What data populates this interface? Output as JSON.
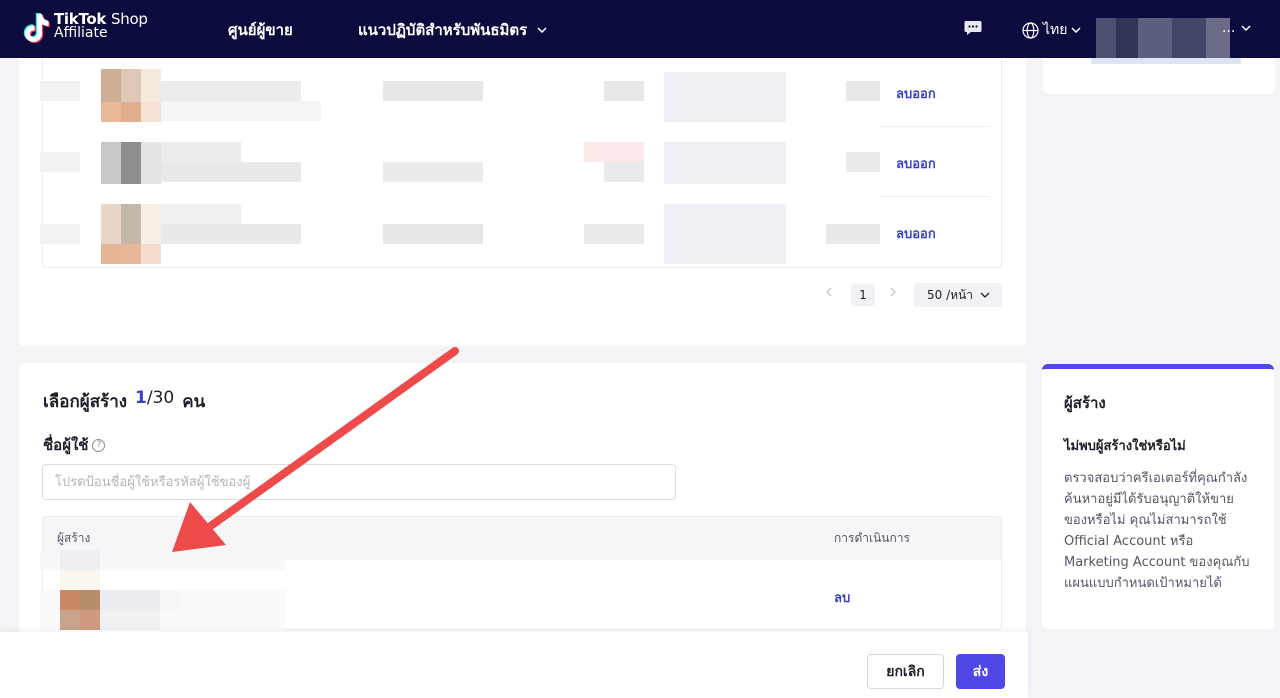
{
  "topbar": {
    "brand_line1": "TikTok",
    "brand_line1b": "Shop",
    "brand_line2": "Affiliate",
    "nav_seller_center": "ศูนย์ผู้ขาย",
    "nav_partner_guidelines": "แนวปฏิบัติสำหรับพันธมิตร",
    "language": "ไทย",
    "account_ellipsis": "..."
  },
  "product_table": {
    "rows": [
      {
        "remove_label": "ลบออก"
      },
      {
        "remove_label": "ลบออก"
      },
      {
        "remove_label": "ลบออก"
      }
    ],
    "pagination": {
      "current_page": "1",
      "page_size": "50 /หน้า"
    }
  },
  "creator_select": {
    "title": "เลือกผู้สร้าง",
    "count_selected": "1",
    "count_total": "/30",
    "count_unit": "คน",
    "username_label": "ชื่อผู้ใช้",
    "username_placeholder": "โปรดป้อนชื่อผู้ใช้หรือรหัสผู้ใช้ของผู้",
    "table_header_creator": "ผู้สร้าง",
    "table_header_action": "การดำเนินการ",
    "delete_label": "ลบ"
  },
  "footer": {
    "cancel_label": "ยกเลิก",
    "send_label": "ส่ง"
  },
  "side_panel": {
    "title": "ผู้สร้าง",
    "question": "ไม่พบผู้สร้างใช่หรือไม่",
    "body": "ตรวจสอบว่าครีเอเตอร์ที่คุณกำลังค้นหาอยู่มีได้รับอนุญาติให้ขายของหรือไม่ คุณไม่สามารถใช้ Official Account หรือ Marketing Account ของคุณกับแผนแบบกำหนดเป้าหมายได้"
  },
  "colors": {
    "topbar_bg": "#0b0b3d",
    "accent": "#5146e6",
    "link": "#3b43c4",
    "annotation_arrow": "#ef4a4a"
  }
}
